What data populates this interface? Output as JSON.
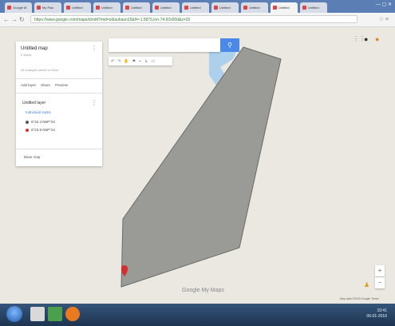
{
  "browser": {
    "tabs": [
      {
        "label": "Google M"
      },
      {
        "label": "My Plac"
      },
      {
        "label": "Untitled"
      },
      {
        "label": "Untitled"
      },
      {
        "label": "Untitled"
      },
      {
        "label": "Untitled"
      },
      {
        "label": "Untitled"
      },
      {
        "label": "Untitled"
      },
      {
        "label": "Untitled"
      },
      {
        "label": "Untitled",
        "active": true
      },
      {
        "label": "Untitled"
      }
    ],
    "url": "https://www.google.com/maps/d/edit?mid=zdlauhaun15&ll=-1.5875,lon-74.92x00d&z=20"
  },
  "panel": {
    "map_title": "Untitled map",
    "map_sub": "0 views",
    "meta": "All changes saved to Drive",
    "actions": [
      "Add layer",
      "Share",
      "Preview"
    ],
    "layer_name": "Untitled layer",
    "layer_style": "Individual styles",
    "items": [
      "9°22.4 N5P°24",
      "9°23.8 N5P°24"
    ],
    "base_map": "Base map"
  },
  "map": {
    "logo": "Google My Maps",
    "attribution": "Map data ©2015 Google   Terms",
    "polygon_color": "#9a9a96",
    "marker_color": "#d32f2f"
  },
  "taskbar": {
    "time": "10:41",
    "date": "06-01-2016"
  }
}
